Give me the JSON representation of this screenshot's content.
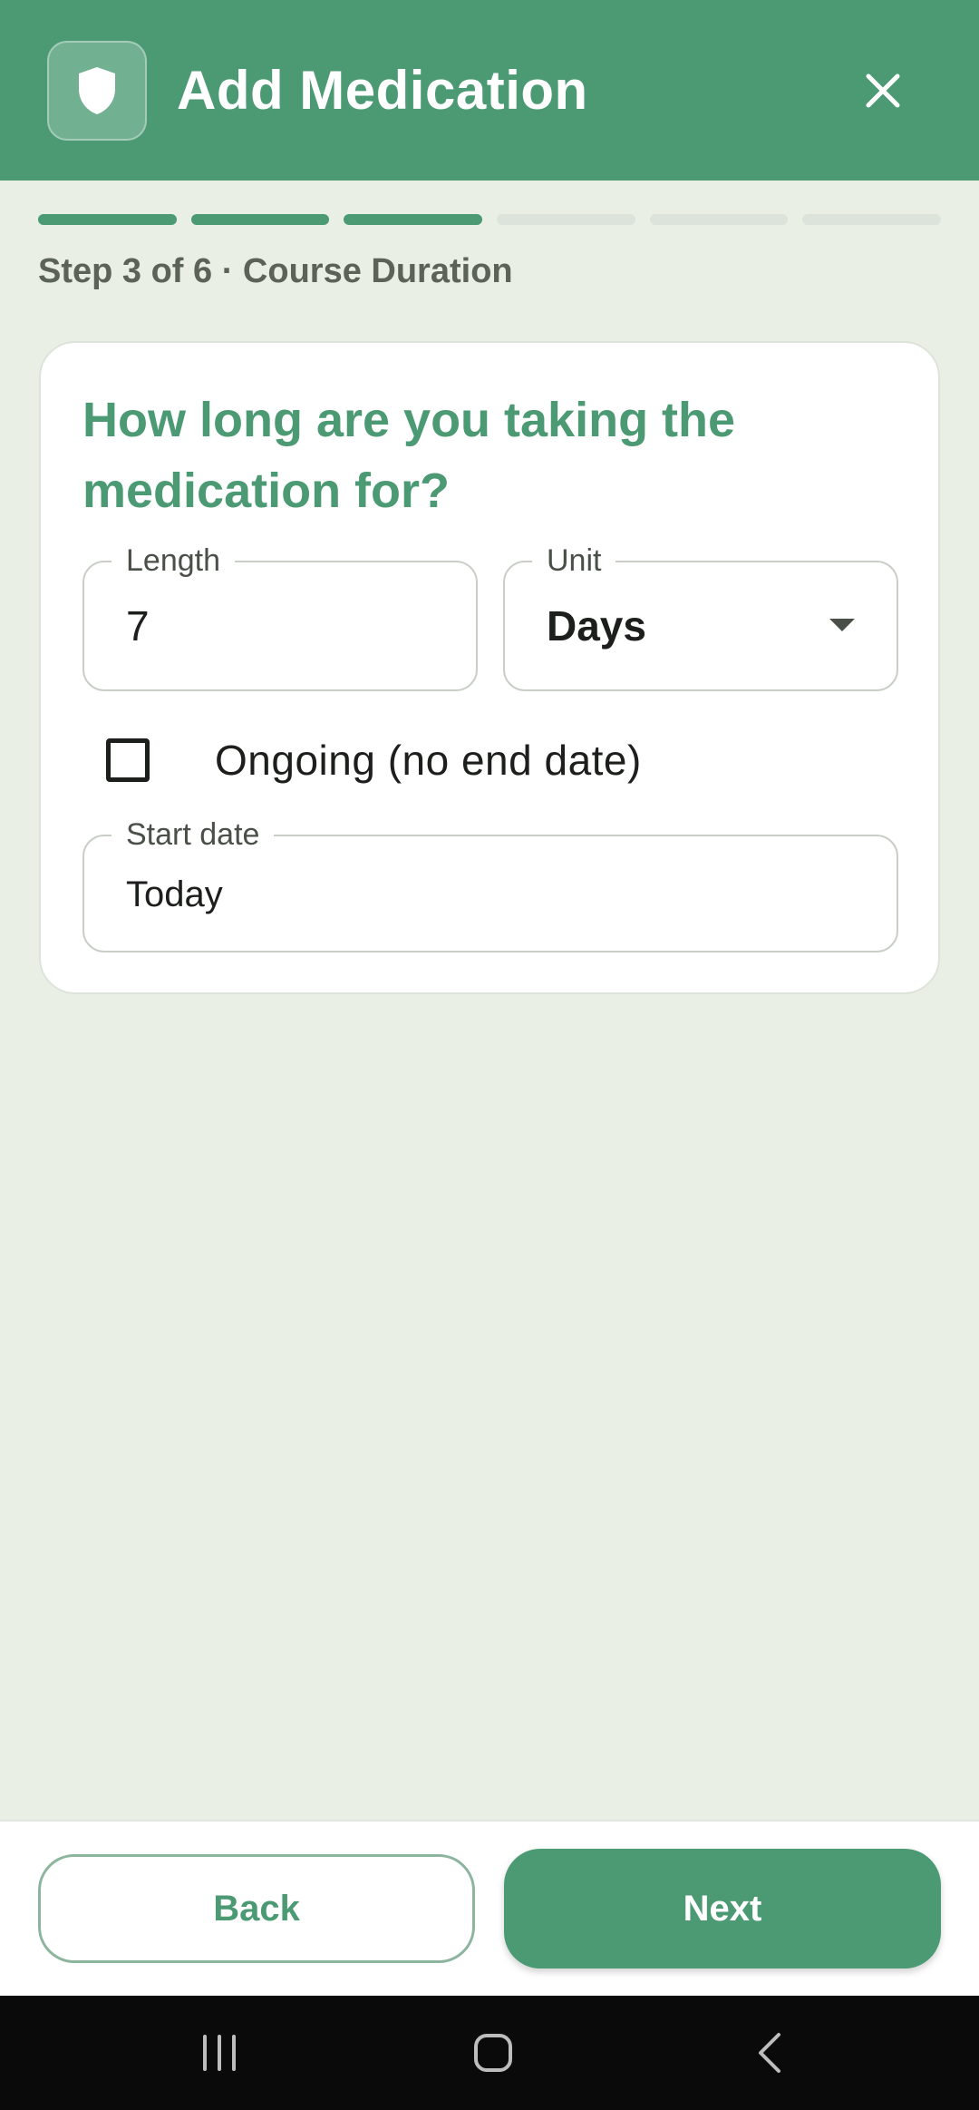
{
  "header": {
    "title": "Add Medication",
    "icon": "shield-icon",
    "close_icon": "close-icon",
    "background_color": "#4B9A74"
  },
  "progress": {
    "current_step": 3,
    "total_steps": 6
  },
  "step_label": "Step 3 of 6 · Course Duration",
  "card": {
    "question": "How long are you taking the medication for?",
    "length": {
      "label": "Length",
      "value": "7"
    },
    "unit": {
      "label": "Unit",
      "value": "Days"
    },
    "ongoing": {
      "label": "Ongoing (no end date)",
      "checked": false
    },
    "start_date": {
      "label": "Start date",
      "value": "Today"
    }
  },
  "footer": {
    "back_label": "Back",
    "next_label": "Next"
  },
  "system_nav": {
    "recents_icon": "recents-icon",
    "home_icon": "home-icon",
    "back_icon": "back-chevron-icon"
  }
}
